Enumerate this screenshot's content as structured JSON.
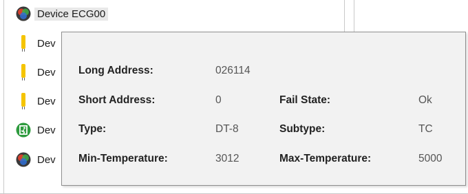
{
  "tree": {
    "items": [
      {
        "label": "Device ECG00",
        "icon": "rgb-device-icon"
      },
      {
        "label": "Dev",
        "icon": "light-tube-icon"
      },
      {
        "label": "Dev",
        "icon": "light-tube-icon"
      },
      {
        "label": "Dev",
        "icon": "light-tube-icon"
      },
      {
        "label": "Dev",
        "icon": "emergency-exit-icon"
      },
      {
        "label": "Dev",
        "icon": "rgb-device-icon"
      }
    ]
  },
  "tooltip": {
    "long_address_label": "Long Address:",
    "long_address_value": "026114",
    "short_address_label": "Short Address:",
    "short_address_value": "0",
    "fail_state_label": "Fail State:",
    "fail_state_value": "Ok",
    "type_label": "Type:",
    "type_value": "DT-8",
    "subtype_label": "Subtype:",
    "subtype_value": "TC",
    "min_temp_label": "Min-Temperature:",
    "min_temp_value": "3012",
    "max_temp_label": "Max-Temperature:",
    "max_temp_value": "5000"
  },
  "colors": {
    "rgb_red": "#e8412d",
    "rgb_green": "#3fae49",
    "rgb_blue": "#2f6fd6",
    "tube_yellow": "#f5c400",
    "exit_green": "#2e9b3e",
    "tooltip_bg": "#f2f2f2"
  }
}
